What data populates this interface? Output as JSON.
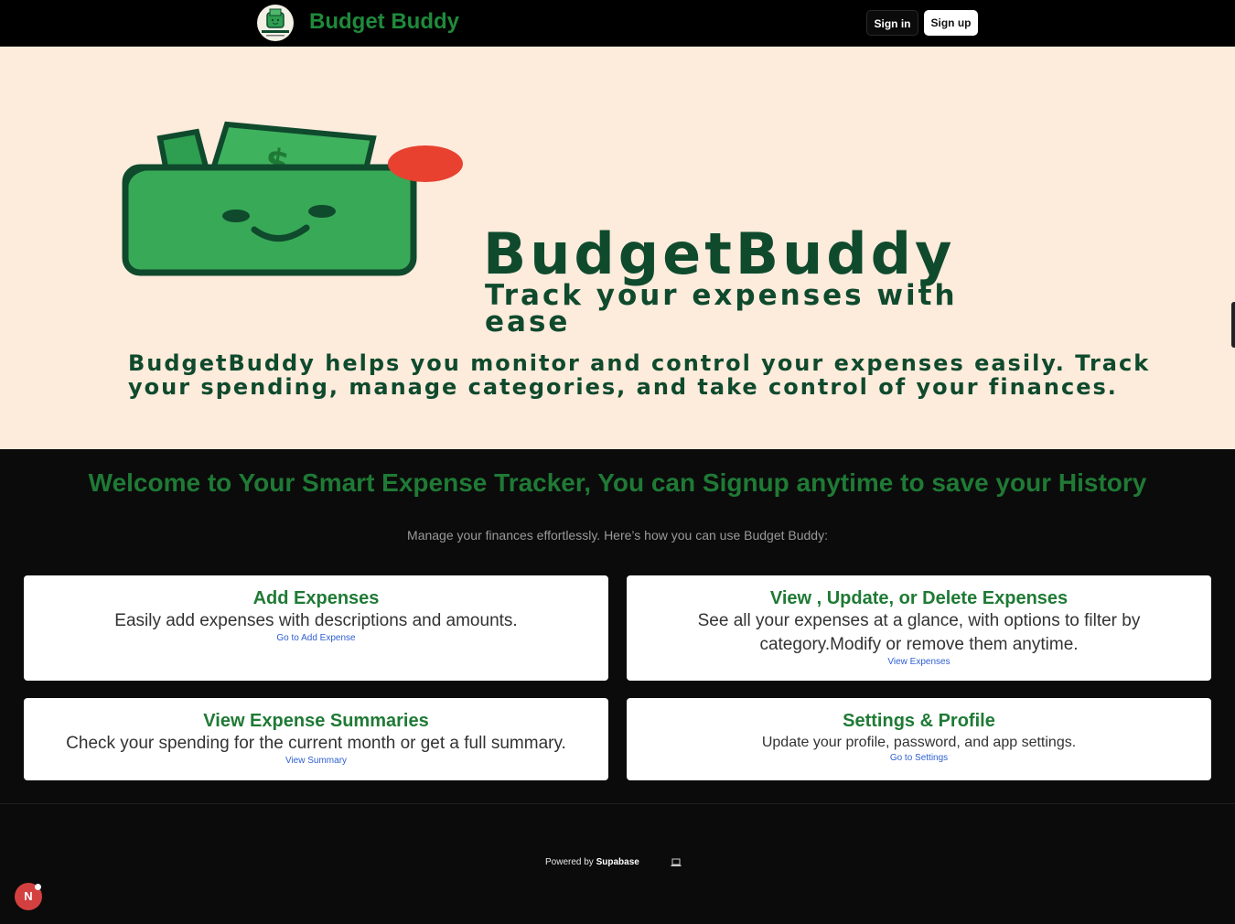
{
  "header": {
    "brand": "Budget Buddy",
    "logo_icon": "wallet-logo-icon",
    "signin_label": "Sign in",
    "signup_label": "Sign up"
  },
  "hero": {
    "title": "BudgetBuddy",
    "tagline": "Track your expenses with ease",
    "description": "BudgetBuddy helps you monitor and control your expenses easily. Track your spending, manage categories, and take control of your finances.",
    "illustration_icon": "smiling-wallet-icon"
  },
  "welcome": {
    "heading": "Welcome to Your Smart Expense Tracker, You can Signup anytime to save your History",
    "subtext": "Manage your finances effortlessly. Here’s how you can use Budget Buddy:"
  },
  "cards": [
    {
      "title": "Add Expenses",
      "description": "Easily add expenses with descriptions and amounts.",
      "link": "Go to Add Expense"
    },
    {
      "title": "View , Update, or Delete Expenses",
      "description": "See all your expenses at a glance, with options to filter by category.Modify or remove them anytime.",
      "link": "View Expenses"
    },
    {
      "title": "View Expense Summaries",
      "description": "Check your spending for the current month or get a full summary.",
      "link": "View Summary"
    },
    {
      "title": "Settings & Profile",
      "description": "Update your profile, password, and app settings.",
      "link": "Go to Settings"
    }
  ],
  "footer": {
    "powered_prefix": "Powered by",
    "powered_brand": "Supabase",
    "theme_icon": "laptop-icon"
  },
  "dev_badge": {
    "letter": "N",
    "icon": "nextjs-badge-icon"
  },
  "colors": {
    "brand_green": "#1f8a3b",
    "hero_bg": "#fdebdc",
    "hero_text": "#0f4a2d",
    "link_blue": "#2f5fd0"
  }
}
